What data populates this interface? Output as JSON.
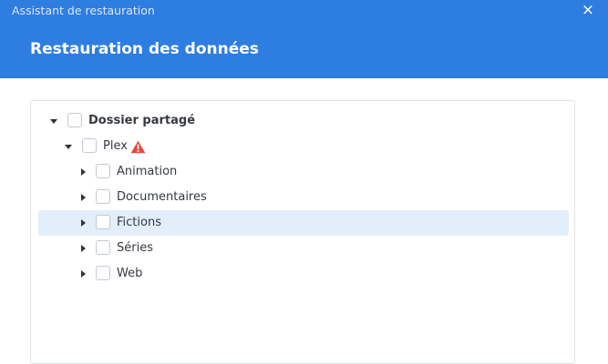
{
  "window": {
    "title": "Assistant de restauration",
    "close_icon": "×",
    "heading": "Restauration des données"
  },
  "tree": {
    "root": {
      "label": "Dossier partagé",
      "expanded": true,
      "checked": false
    },
    "plex": {
      "label": "Plex",
      "expanded": true,
      "checked": false,
      "warning": true
    },
    "children": [
      {
        "label": "Animation",
        "expanded": false,
        "checked": false,
        "selected": false
      },
      {
        "label": "Documentaires",
        "expanded": false,
        "checked": false,
        "selected": false
      },
      {
        "label": "Fictions",
        "expanded": false,
        "checked": false,
        "selected": true
      },
      {
        "label": "Séries",
        "expanded": false,
        "checked": false,
        "selected": false
      },
      {
        "label": "Web",
        "expanded": false,
        "checked": false,
        "selected": false
      }
    ]
  },
  "colors": {
    "header": "#2e7de0",
    "selection": "#e2eefa",
    "warning": "#e24a3b"
  }
}
